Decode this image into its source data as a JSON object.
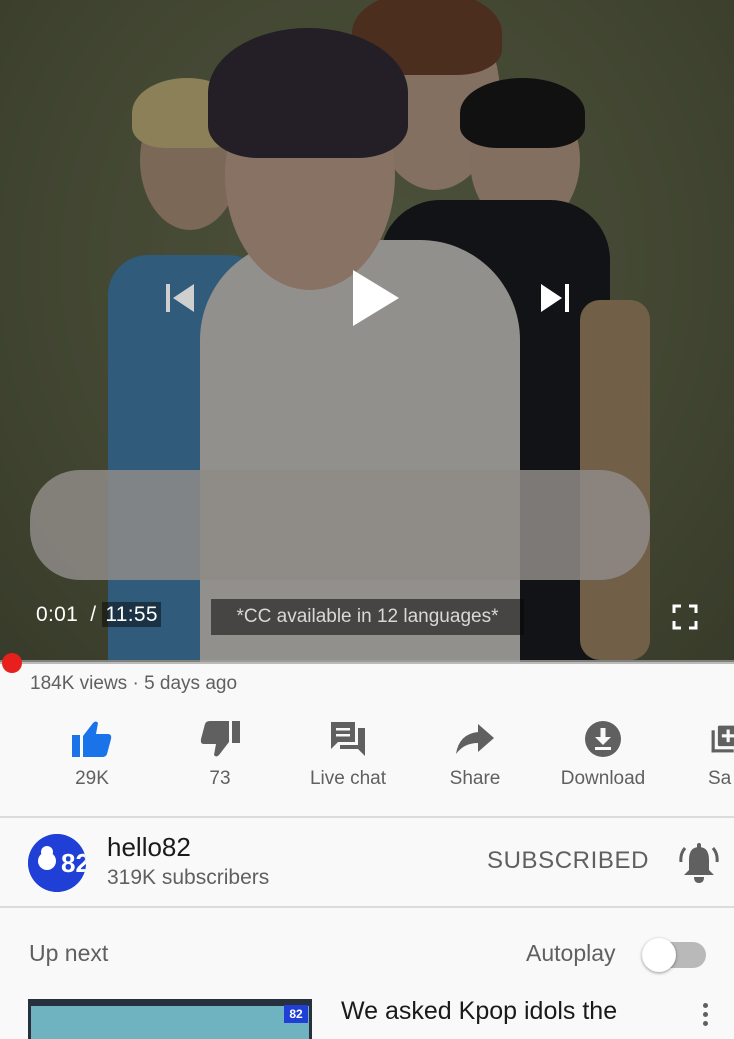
{
  "player": {
    "current_time": "0:01",
    "separator": "/",
    "duration": "11:55",
    "cc_notice": "*CC available in 12 languages*",
    "progress_fraction": 0.0014
  },
  "video": {
    "views": "184K views",
    "dot": "·",
    "age": "5 days ago"
  },
  "actions": [
    {
      "label": "29K",
      "icon": "thumbs-up-icon",
      "active": true
    },
    {
      "label": "73",
      "icon": "thumbs-down-icon"
    },
    {
      "label": "Live chat",
      "icon": "live-chat-icon"
    },
    {
      "label": "Share",
      "icon": "share-icon"
    },
    {
      "label": "Download",
      "icon": "download-icon"
    },
    {
      "label": "Sa",
      "icon": "save-playlist-icon"
    }
  ],
  "channel": {
    "name": "hello82",
    "subscribers": "319K subscribers",
    "avatar_text": "82",
    "subscribe_state": "SUBSCRIBED"
  },
  "up_next": {
    "heading": "Up next",
    "autoplay_label": "Autoplay",
    "autoplay_on": false,
    "first_item": {
      "title": "We asked Kpop idols the",
      "badge": "82"
    }
  },
  "colors": {
    "accent_red": "#e8201d",
    "like_blue": "#1a73e8",
    "brand_blue": "#1f3fd6",
    "secondary_text": "#606060"
  }
}
